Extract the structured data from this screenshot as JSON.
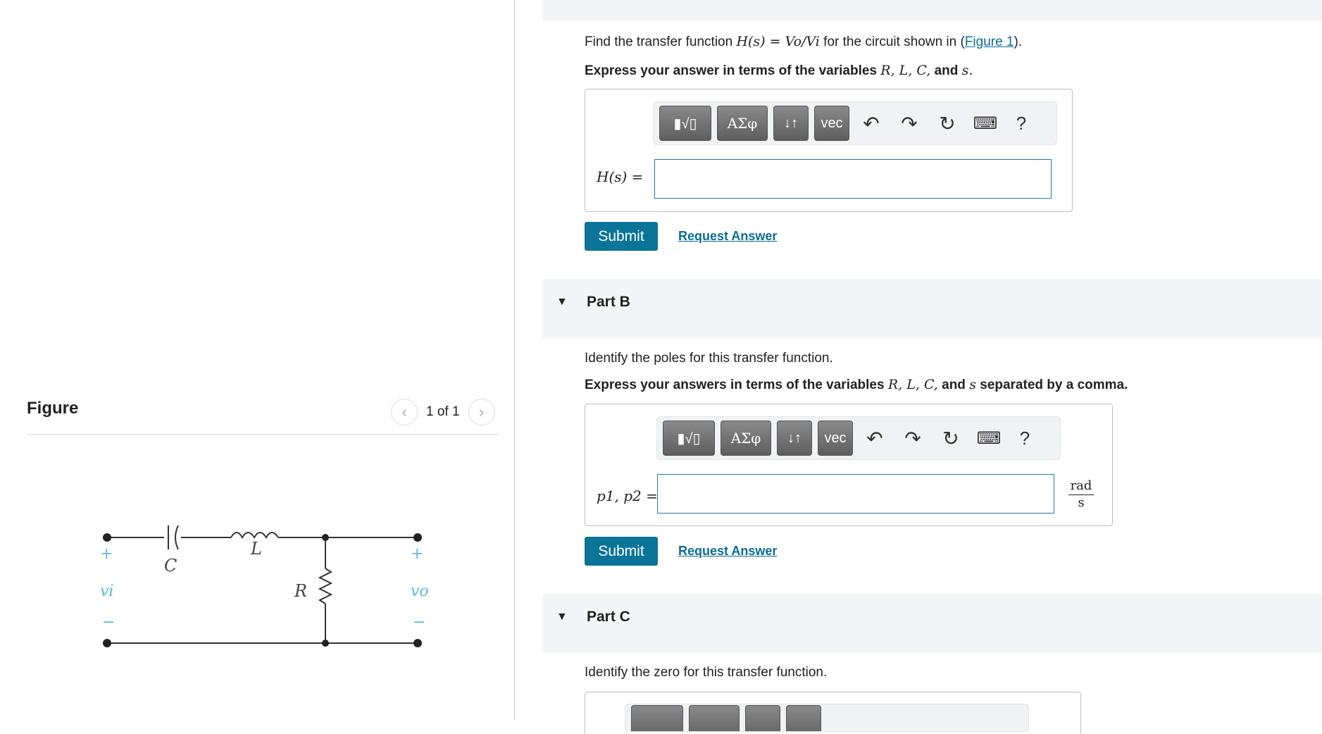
{
  "figure": {
    "title": "Figure",
    "pager": "1 of 1",
    "prev_icon": "chevron-left-icon",
    "next_icon": "chevron-right-icon",
    "labels": {
      "C": "C",
      "L": "L",
      "R": "R",
      "vi": "vi",
      "vo": "vo",
      "plus": "+",
      "minus": "−"
    }
  },
  "partA": {
    "prompt_prefix": "Find the transfer function",
    "prompt_math": "H(s) = Vo/Vi",
    "prompt_mid": "for the circuit shown in (",
    "figure_link": "Figure 1",
    "prompt_suffix": ").",
    "instruction_prefix": "Express your answer in terms of the variables",
    "instruction_vars": "R, L, C,",
    "instruction_and": "and",
    "instruction_s": "s.",
    "input_label": "H(s) =",
    "submit": "Submit",
    "request": "Request Answer"
  },
  "toolbar": {
    "k1": "▮√▯",
    "k2": "ΑΣφ",
    "k3": "↓↑",
    "k4": "vec",
    "undo_icon": "undo-icon",
    "redo_icon": "redo-icon",
    "reset_icon": "reset-icon",
    "keyboard_icon": "keyboard-icon",
    "help": "?"
  },
  "partB": {
    "title": "Part B",
    "prompt": "Identify the poles for this transfer function.",
    "instruction_prefix": "Express your answers in terms of the variables",
    "instruction_vars": "R, L, C,",
    "instruction_and": "and",
    "instruction_s": "s",
    "instruction_suffix": "separated by a comma.",
    "input_label": "p1, p2 =",
    "units_num": "rad",
    "units_den": "s",
    "submit": "Submit",
    "request": "Request Answer"
  },
  "partC": {
    "title": "Part C",
    "prompt": "Identify the zero for this transfer function."
  },
  "colors": {
    "accent": "#0b7499",
    "link": "#0b6d96",
    "band": "#f4f5f7",
    "terminal_label": "#5bb8e0"
  }
}
